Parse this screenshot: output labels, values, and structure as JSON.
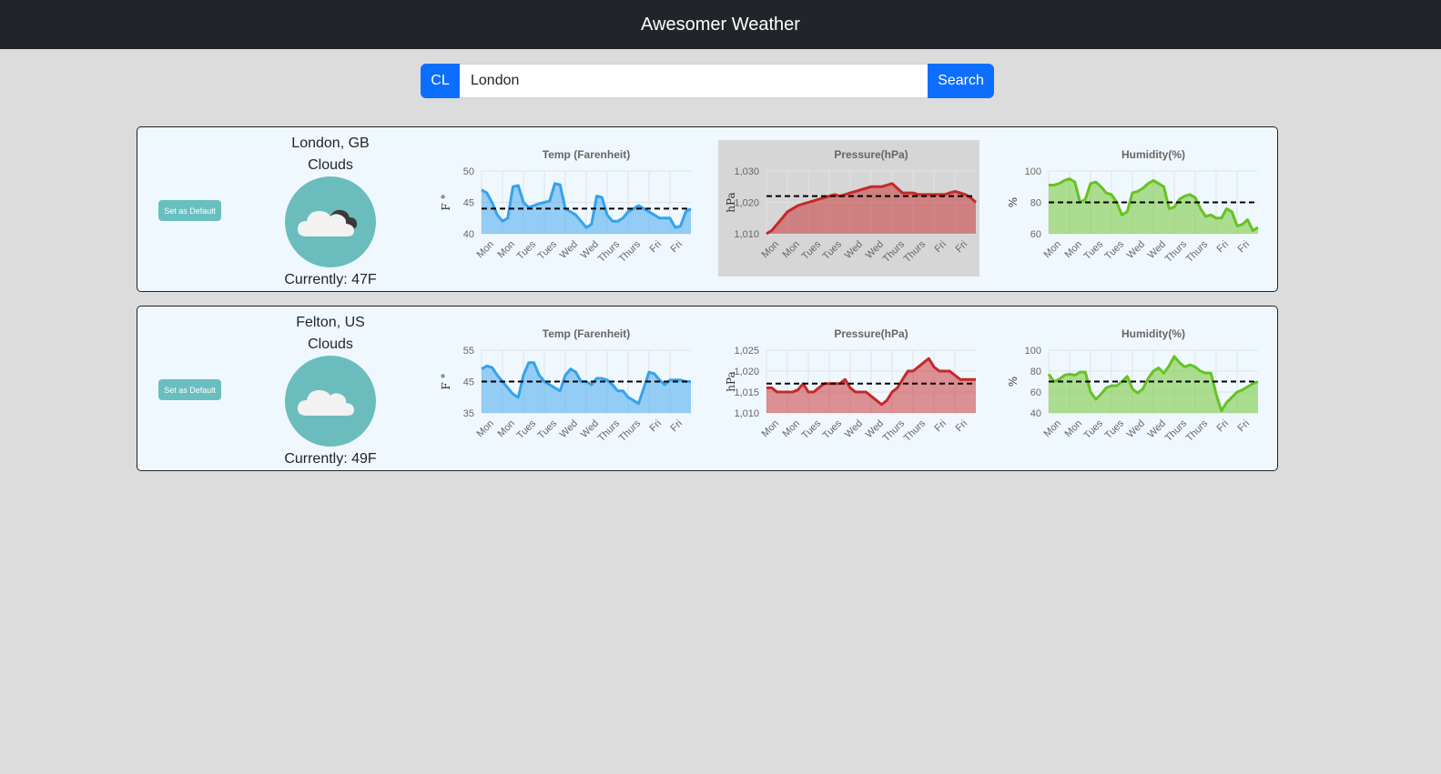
{
  "app": {
    "title": "Awesomer Weather"
  },
  "search": {
    "cl_label": "CL",
    "value": "London",
    "button_label": "Search"
  },
  "cards": [
    {
      "default_label": "Set as Default",
      "location": "London, GB",
      "condition": "Clouds",
      "current": "Currently: 47F",
      "icon": "clouds-night-icon",
      "chart_data": [
        {
          "type": "area",
          "title": "Temp (Farenheit)",
          "ylabel": "F °",
          "color": "#36a2eb",
          "fill": "rgba(54,162,235,0.5)",
          "ylim": [
            40,
            50
          ],
          "yticks": [
            "50",
            "45",
            "40"
          ],
          "ytick_values": [
            50,
            45,
            40
          ],
          "average": 44,
          "categories": [
            "Mon",
            "Mon",
            "Tues",
            "Tues",
            "Wed",
            "Wed",
            "Thurs",
            "Thurs",
            "Fri",
            "Fri"
          ],
          "values": [
            47,
            46.5,
            45,
            43,
            42,
            42.5,
            47.5,
            47.7,
            45,
            44.2,
            44.5,
            44.8,
            45,
            45.2,
            48,
            47.8,
            44,
            43.5,
            43,
            42,
            41,
            41.5,
            46,
            45.8,
            43,
            42,
            42,
            42.5,
            43.5,
            44,
            44.5,
            44,
            43.5,
            43,
            42.5,
            42.5,
            42.5,
            41,
            41.2,
            43.5,
            44
          ]
        },
        {
          "type": "area",
          "title": "Pressure(hPa)",
          "ylabel": "hPa",
          "color": "#c62828",
          "fill": "rgba(198,40,40,0.5)",
          "background": "gray",
          "ylim": [
            1010,
            1030
          ],
          "yticks": [
            "1,030",
            "1,020",
            "1,010"
          ],
          "ytick_values": [
            1030,
            1020,
            1010
          ],
          "average": 1022,
          "categories": [
            "Mon",
            "Mon",
            "Tues",
            "Tues",
            "Wed",
            "Wed",
            "Thurs",
            "Thurs",
            "Fri",
            "Fri"
          ],
          "values": [
            1010,
            1011,
            1013,
            1015,
            1017,
            1018,
            1019,
            1019.5,
            1020,
            1020.5,
            1021,
            1021.5,
            1022,
            1022.5,
            1022,
            1022.5,
            1023,
            1023.5,
            1024,
            1024.5,
            1025,
            1025,
            1025,
            1025.5,
            1026,
            1024.5,
            1023,
            1023,
            1023,
            1022.5,
            1022.5,
            1022.5,
            1022.5,
            1022.5,
            1022.5,
            1023,
            1023.5,
            1023,
            1022.5,
            1021.5,
            1020
          ]
        },
        {
          "type": "area",
          "title": "Humidity(%)",
          "ylabel": "%",
          "color": "#66c221",
          "fill": "rgba(102,194,33,0.5)",
          "ylim": [
            60,
            100
          ],
          "yticks": [
            "100",
            "80",
            "60"
          ],
          "ytick_values": [
            100,
            80,
            60
          ],
          "average": 80,
          "categories": [
            "Mon",
            "Mon",
            "Tues",
            "Tues",
            "Wed",
            "Wed",
            "Thurs",
            "Thurs",
            "Fri",
            "Fri"
          ],
          "values": [
            91,
            91,
            92,
            94,
            95,
            93,
            80,
            82,
            92,
            93,
            90,
            86,
            85,
            80,
            72,
            74,
            86,
            87,
            89,
            92,
            94,
            92,
            90,
            76,
            77,
            82,
            84,
            85,
            83,
            76,
            71,
            72,
            70,
            70,
            76,
            74,
            65,
            66,
            69,
            62,
            64
          ]
        }
      ]
    },
    {
      "default_label": "Set as Default",
      "location": "Felton, US",
      "condition": "Clouds",
      "current": "Currently: 49F",
      "icon": "clouds-icon",
      "chart_data": [
        {
          "type": "area",
          "title": "Temp (Farenheit)",
          "ylabel": "F °",
          "color": "#36a2eb",
          "fill": "rgba(54,162,235,0.5)",
          "ylim": [
            35,
            55
          ],
          "yticks": [
            "55",
            "45",
            "35"
          ],
          "ytick_values": [
            55,
            45,
            35
          ],
          "average": 45,
          "categories": [
            "Mon",
            "Mon",
            "Tues",
            "Tues",
            "Wed",
            "Wed",
            "Thurs",
            "Thurs",
            "Fri",
            "Fri"
          ],
          "values": [
            49,
            50,
            49.5,
            47,
            45,
            43,
            41,
            40,
            47,
            51,
            51,
            47,
            45,
            44,
            43,
            42,
            47,
            49,
            48,
            45,
            45,
            44,
            46,
            46,
            45.5,
            44,
            42,
            42,
            40,
            39,
            38,
            43,
            48,
            47.5,
            45.5,
            44,
            45.5,
            45.5,
            45.5,
            45,
            45
          ]
        },
        {
          "type": "area",
          "title": "Pressure(hPa)",
          "ylabel": "hPa",
          "color": "#c62828",
          "fill": "rgba(198,40,40,0.5)",
          "ylim": [
            1010,
            1025
          ],
          "yticks": [
            "1,025",
            "1,020",
            "1,015",
            "1,010"
          ],
          "ytick_values": [
            1025,
            1020,
            1015,
            1010
          ],
          "average": 1017,
          "categories": [
            "Mon",
            "Mon",
            "Tues",
            "Tues",
            "Wed",
            "Wed",
            "Thurs",
            "Thurs",
            "Fri",
            "Fri"
          ],
          "values": [
            1016,
            1016,
            1015,
            1015,
            1015,
            1015,
            1015.5,
            1017,
            1015,
            1015,
            1016,
            1017,
            1017,
            1017,
            1017,
            1018,
            1016,
            1015,
            1015,
            1015,
            1014,
            1013,
            1012,
            1013,
            1015,
            1016,
            1018,
            1020,
            1020,
            1021,
            1022,
            1023,
            1021,
            1020,
            1020,
            1020,
            1019,
            1018,
            1018,
            1018,
            1018
          ]
        },
        {
          "type": "area",
          "title": "Humidity(%)",
          "ylabel": "%",
          "color": "#66c221",
          "fill": "rgba(102,194,33,0.5)",
          "ylim": [
            40,
            100
          ],
          "yticks": [
            "100",
            "80",
            "60",
            "40"
          ],
          "ytick_values": [
            100,
            80,
            60,
            40
          ],
          "average": 70,
          "categories": [
            "Mon",
            "Mon",
            "Tues",
            "Tues",
            "Wed",
            "Wed",
            "Thurs",
            "Thurs",
            "Fri",
            "Fri"
          ],
          "values": [
            77,
            70,
            72,
            76,
            77,
            76,
            79,
            79,
            60,
            53,
            58,
            64,
            66,
            66,
            70,
            75,
            63,
            59,
            63,
            73,
            80,
            83,
            78,
            85,
            94,
            88,
            84,
            86,
            84,
            80,
            78,
            78,
            58,
            42,
            50,
            55,
            60,
            62,
            65,
            68,
            70
          ]
        }
      ]
    }
  ]
}
